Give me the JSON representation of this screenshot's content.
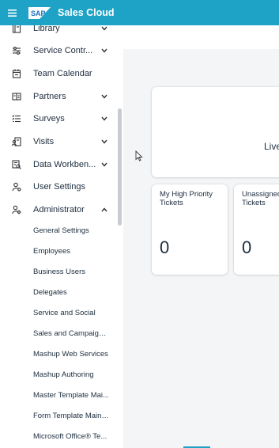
{
  "header": {
    "menu_icon": "hamburger-icon",
    "logo_text": "SAP",
    "title": "Sales Cloud",
    "color": "#1ea3c6"
  },
  "sidebar": {
    "items": [
      {
        "label": "Library",
        "icon": "library-icon",
        "expandable": true
      },
      {
        "label": "Service Contr...",
        "icon": "service-control-icon",
        "expandable": true
      },
      {
        "label": "Team Calendar",
        "icon": "calendar-icon",
        "expandable": false
      },
      {
        "label": "Partners",
        "icon": "partners-icon",
        "expandable": true
      },
      {
        "label": "Surveys",
        "icon": "surveys-icon",
        "expandable": true
      },
      {
        "label": "Visits",
        "icon": "visits-icon",
        "expandable": true
      },
      {
        "label": "Data Workben...",
        "icon": "data-workbench-icon",
        "expandable": true
      },
      {
        "label": "User Settings",
        "icon": "user-settings-icon",
        "expandable": false
      },
      {
        "label": "Administrator",
        "icon": "administrator-icon",
        "expandable": true,
        "expanded": true
      }
    ],
    "admin_subitems": [
      "General Settings",
      "Employees",
      "Business Users",
      "Delegates",
      "Service and Social",
      "Sales and Campaign ...",
      "Mashup Web Services",
      "Mashup Authoring",
      "Master Template Mai...",
      "Form Template Maint...",
      "Microsoft Office® Te..."
    ]
  },
  "main": {
    "live_card_text": "Live",
    "tiles": [
      {
        "title": "My High Priority Tickets",
        "value": "0"
      },
      {
        "title": "Unassigned Tickets",
        "value": "0"
      }
    ]
  }
}
